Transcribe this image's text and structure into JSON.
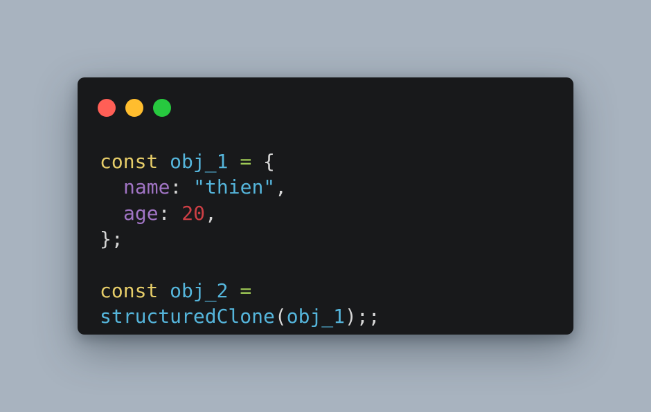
{
  "window": {
    "buttons": [
      {
        "name": "close",
        "color": "#ff5f56"
      },
      {
        "name": "minimize",
        "color": "#ffbd2e"
      },
      {
        "name": "maximize",
        "color": "#27c93f"
      }
    ]
  },
  "code": {
    "line1": {
      "kw": "const",
      "var": "obj_1",
      "op": "=",
      "brace": "{"
    },
    "line2": {
      "prop": "name",
      "colon": ":",
      "str": "\"thien\"",
      "comma": ","
    },
    "line3": {
      "prop": "age",
      "colon": ":",
      "num": "20",
      "comma": ","
    },
    "line4": {
      "close": "};"
    },
    "line6": {
      "kw": "const",
      "var": "obj_2",
      "op": "="
    },
    "line7": {
      "fn": "structuredClone",
      "open": "(",
      "arg": "obj_1",
      "close": ");;"
    }
  }
}
